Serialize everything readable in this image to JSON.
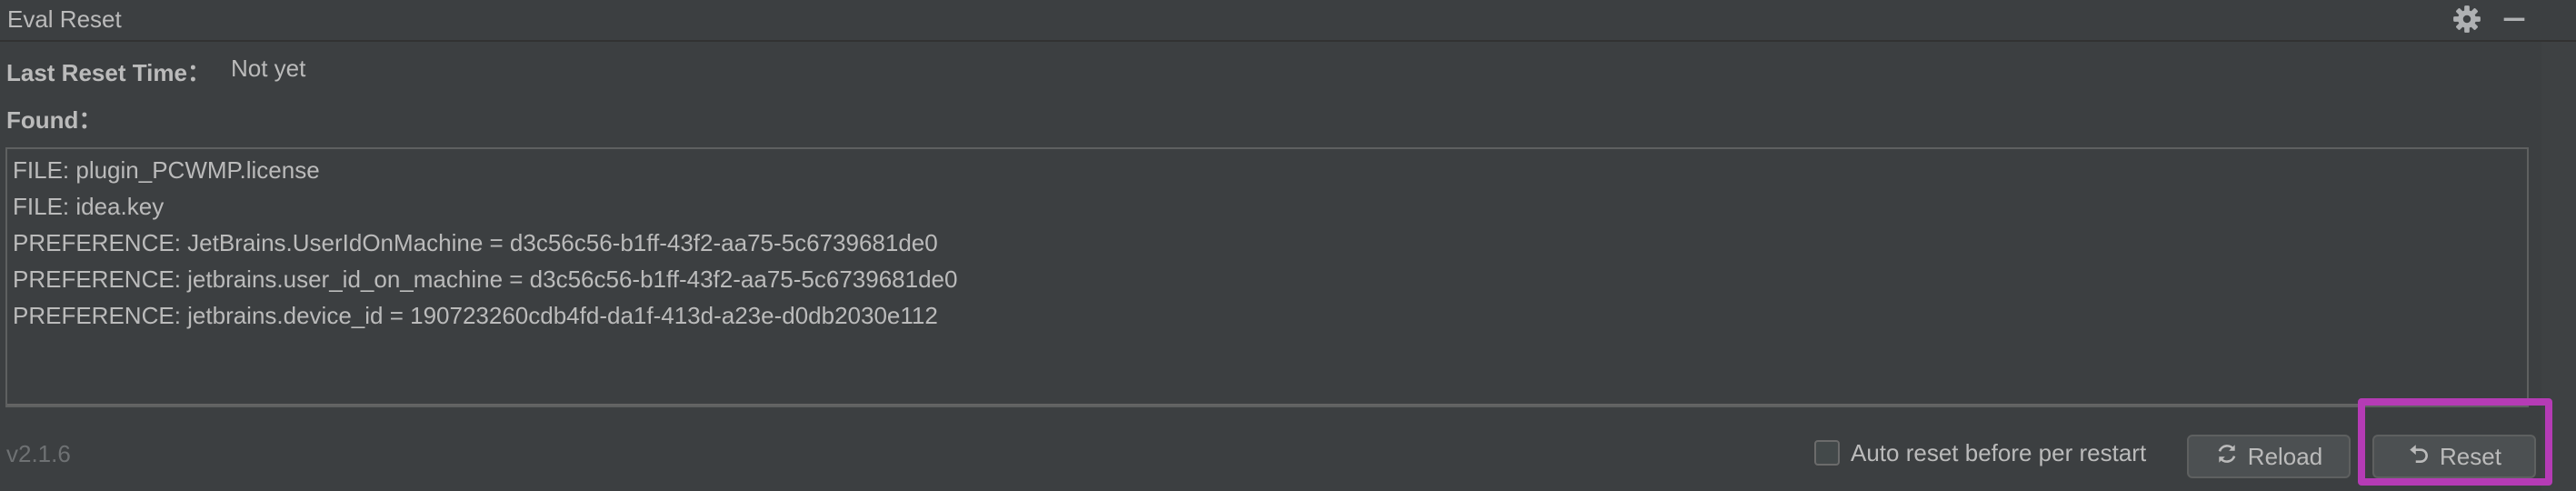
{
  "window": {
    "title": "Eval Reset",
    "icons": [
      "gear-icon",
      "minimize-icon"
    ]
  },
  "info": {
    "last_reset_label": "Last Reset Time：",
    "last_reset_value": "Not yet",
    "found_label": "Found："
  },
  "found": [
    "FILE: plugin_PCWMP.license",
    "FILE: idea.key",
    "PREFERENCE: JetBrains.UserIdOnMachine = d3c56c56-b1ff-43f2-aa75-5c6739681de0",
    "PREFERENCE: jetbrains.user_id_on_machine = d3c56c56-b1ff-43f2-aa75-5c6739681de0",
    "PREFERENCE: jetbrains.device_id = 190723260cdb4fd-da1f-413d-a23e-d0db2030e112"
  ],
  "footer": {
    "version": "v2.1.6",
    "auto_reset_label": "Auto reset before per restart",
    "auto_reset_checked": false,
    "reload_label": "Reload",
    "reset_label": "Reset"
  },
  "colors": {
    "background": "#3c3f41",
    "text": "#bbbbbb",
    "highlight": "#b53bb5"
  }
}
